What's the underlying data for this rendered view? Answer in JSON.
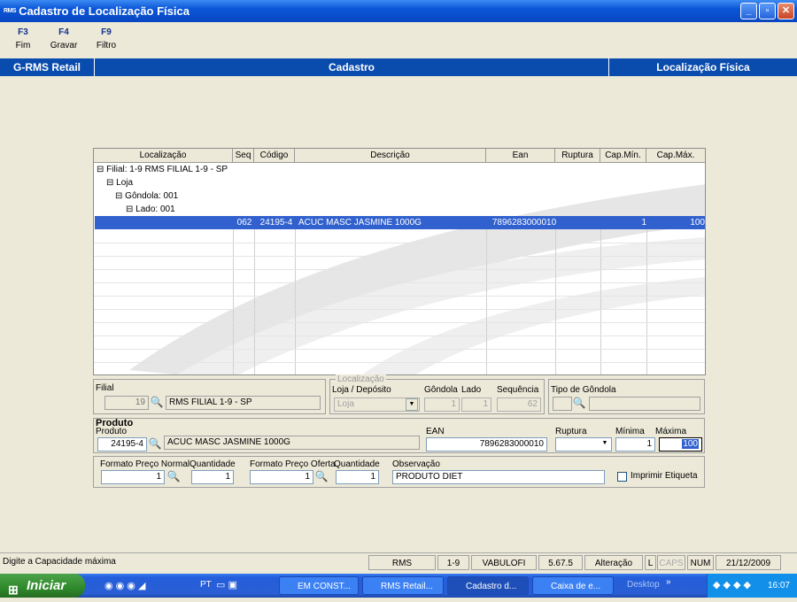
{
  "window": {
    "app_icon": "RMS",
    "title": "Cadastro de Localização Física",
    "minimize": "_",
    "maximize": "▫",
    "close": "✕"
  },
  "fkeys": [
    {
      "key": "F3",
      "label": "Fim"
    },
    {
      "key": "F4",
      "label": "Gravar"
    },
    {
      "key": "F9",
      "label": "Filtro"
    }
  ],
  "band": {
    "left": "G-RMS Retail",
    "center": "Cadastro",
    "right": "Localização Física"
  },
  "grid": {
    "columns": [
      "Localização",
      "Seq",
      "Código",
      "Descrição",
      "Ean",
      "Ruptura",
      "Cap.Mín.",
      "Cap.Máx."
    ],
    "tree": [
      "Filial: 1-9  RMS FILIAL 1-9 - SP",
      "Loja",
      "Gôndola: 001",
      "Lado: 001"
    ],
    "row": {
      "seq": "062",
      "codigo": "24195-4",
      "descricao": "ACUC MASC JASMINE 1000G",
      "ean": "7896283000010",
      "ruptura": "",
      "cap_min": "1",
      "cap_max": "100"
    }
  },
  "form": {
    "filial_label": "Filial",
    "filial_code": "19",
    "filial_name": "RMS FILIAL 1-9 - SP",
    "localizacao_group": "Localização",
    "loja_deposito_label": "Loja / Depósito",
    "loja_deposito_value": "Loja",
    "gondola_label": "Gôndola",
    "gondola_value": "1",
    "lado_label": "Lado",
    "lado_value": "1",
    "sequencia_label": "Sequência",
    "sequencia_value": "62",
    "tipo_gondola_label": "Tipo de Gôndola",
    "produto_group": "Produto",
    "produto_label": "Produto",
    "produto_code": "24195-4",
    "produto_name": "ACUC MASC JASMINE 1000G",
    "ean_label": "EAN",
    "ean_value": "7896283000010",
    "ruptura_label": "Ruptura",
    "minima_label": "Mínima",
    "minima_value": "1",
    "maxima_label": "Máxima",
    "maxima_value": "100",
    "fpn_label": "Formato Preço Normal",
    "fpn_value": "1",
    "qtd1_label": "Quantidade",
    "qtd1_value": "1",
    "fpo_label": "Formato Preço Oferta",
    "fpo_value": "1",
    "qtd2_label": "Quantidade",
    "qtd2_value": "1",
    "obs_label": "Observação",
    "obs_value": "PRODUTO DIET",
    "imprimir_label": "Imprimir Etiqueta"
  },
  "status": {
    "message": "Digite a Capacidade máxima",
    "app": "RMS",
    "filial": "1-9",
    "user": "VABULOFI",
    "version": "5.67.5",
    "mode": "Alteração",
    "l": "L",
    "caps": "CAPS",
    "num": "NUM",
    "date": "21/12/2009"
  },
  "taskbar": {
    "start": "Iniciar",
    "lang": "PT",
    "tasks": [
      "EM CONST...",
      "RMS Retail...",
      "Cadastro d...",
      "Caixa de e..."
    ],
    "desktop": "Desktop",
    "time": "16:07"
  },
  "colors": {
    "title": "#0a56d8",
    "band": "#0a4cad",
    "selection": "#3161ce"
  }
}
